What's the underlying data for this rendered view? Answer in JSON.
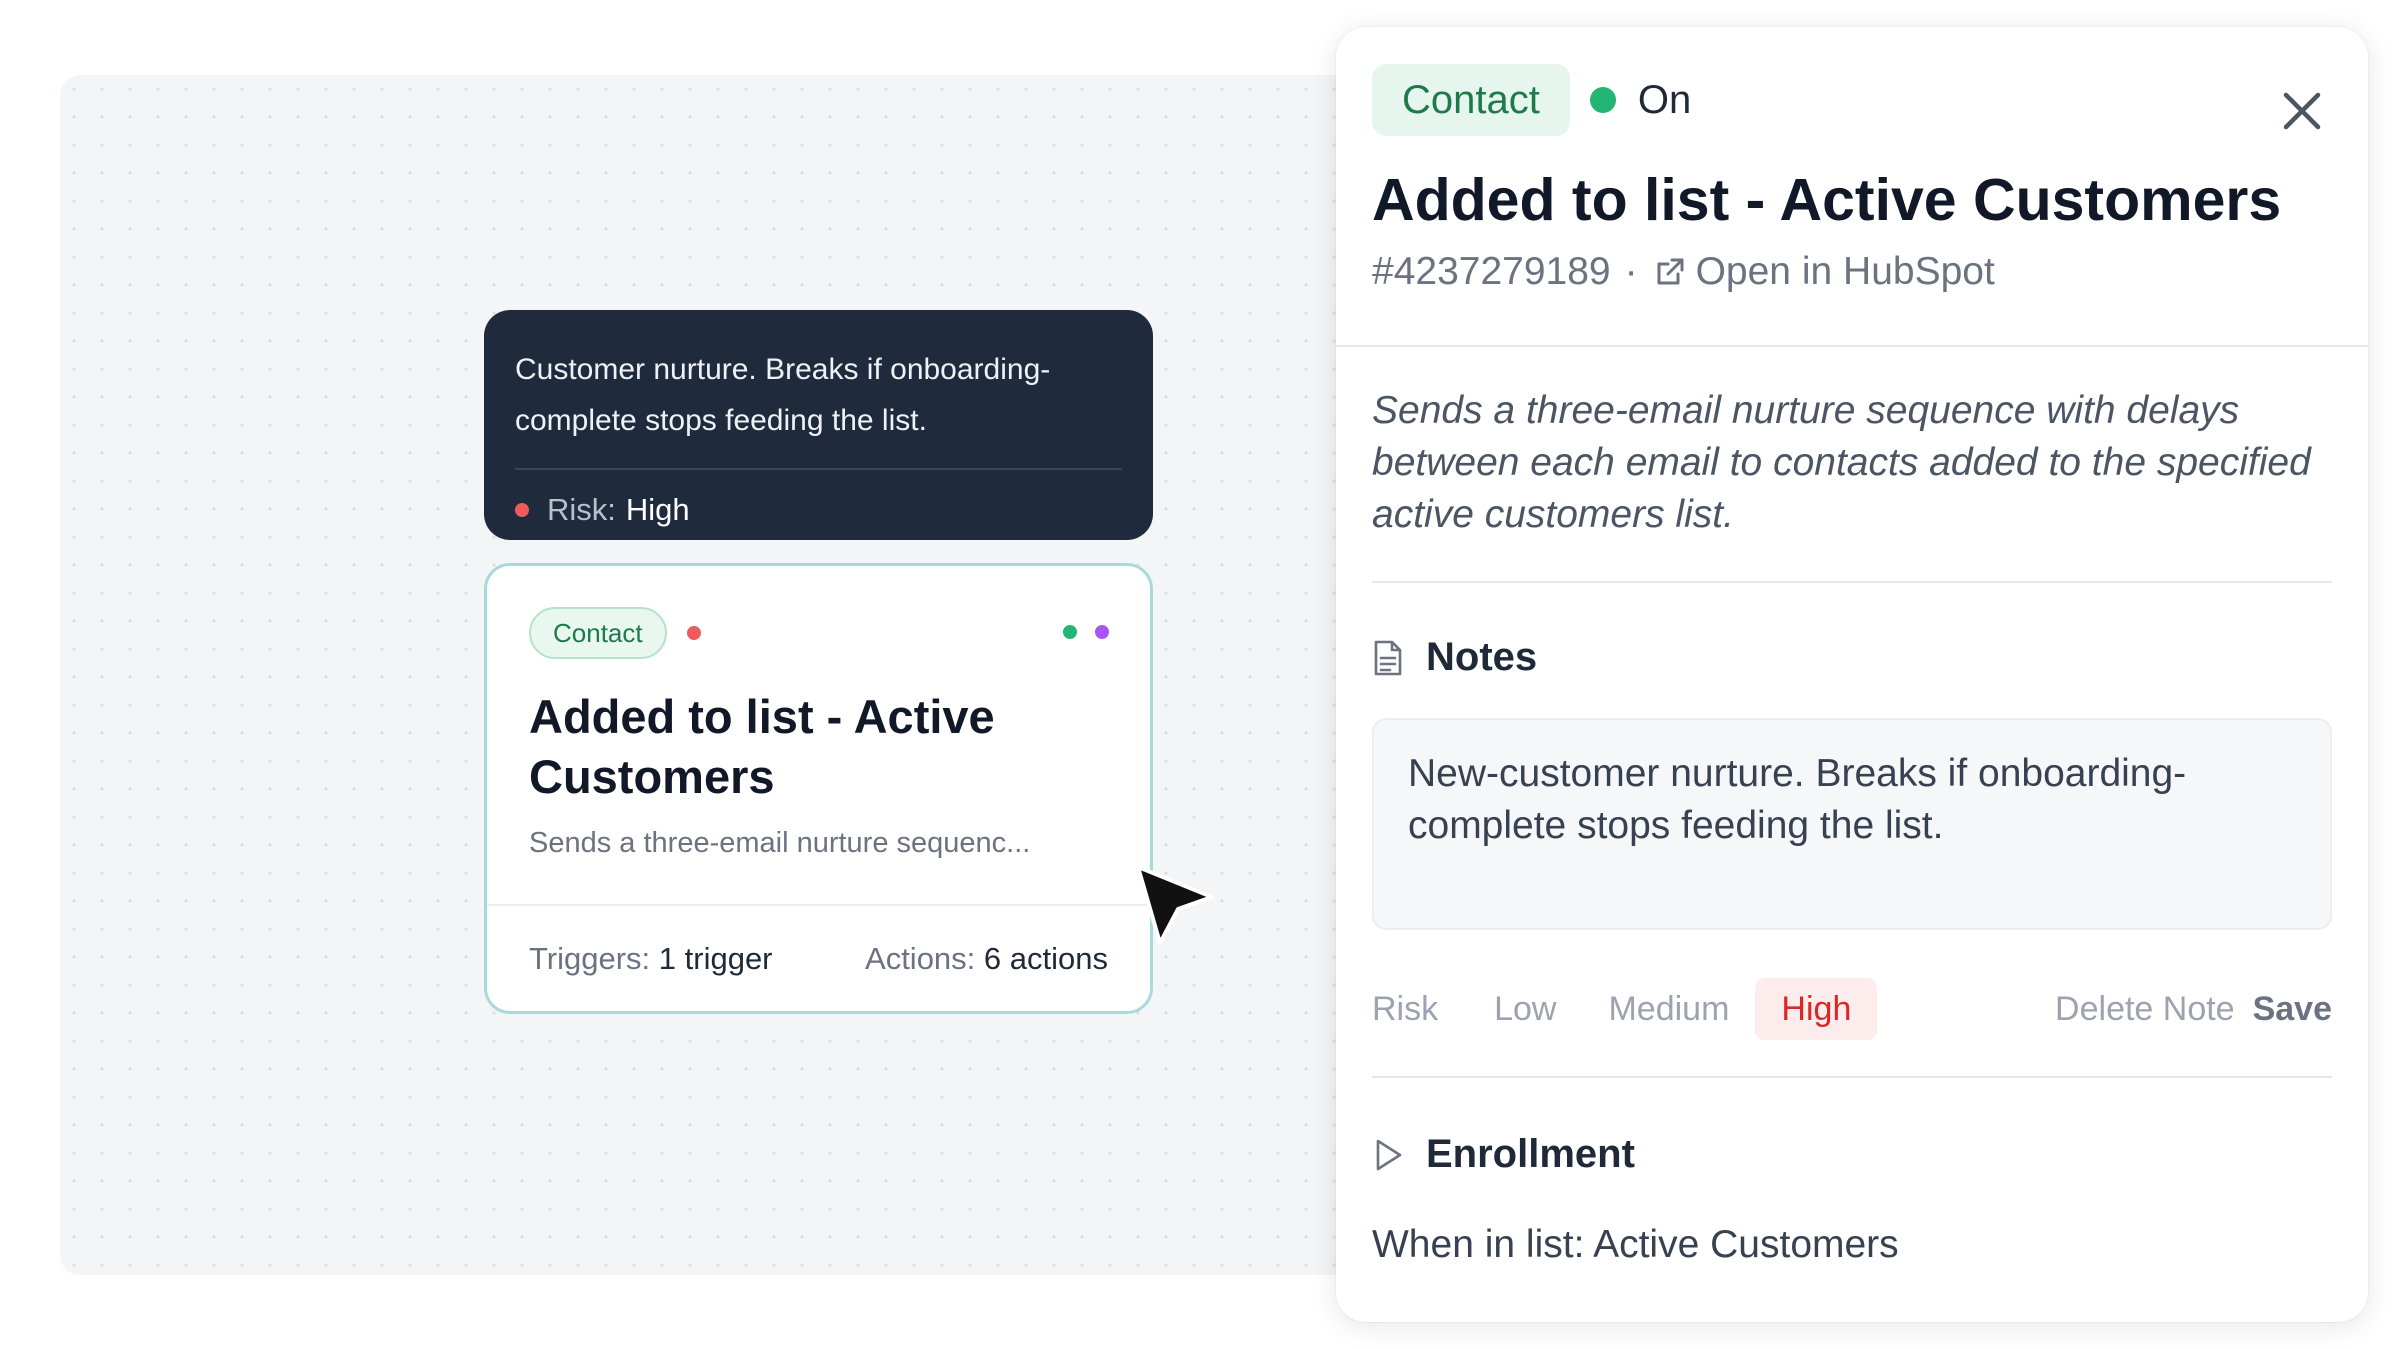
{
  "tooltip": {
    "description": "Customer nurture. Breaks if onboarding-complete stops feeding the list.",
    "risk_label": "Risk:",
    "risk_value": "High"
  },
  "card": {
    "tag": "Contact",
    "title": "Added to list - Active Customers",
    "description": "Sends a three-email nurture sequenc...",
    "triggers_label": "Triggers:",
    "triggers_value": "1 trigger",
    "actions_label": "Actions:",
    "actions_value": "6 actions",
    "status_dots": [
      "#22b573",
      "#a855f7"
    ]
  },
  "panel": {
    "tag": "Contact",
    "status": "On",
    "title": "Added to list - Active Customers",
    "id": "#4237279189",
    "separator": "·",
    "open_link": "Open in HubSpot",
    "description": "Sends a three-email nurture sequence with delays between each email to contacts added to the specified active customers list.",
    "notes": {
      "heading": "Notes",
      "text": "New-customer nurture. Breaks if onboarding-complete stops feeding the list."
    },
    "risk": {
      "label": "Risk",
      "options": [
        "Low",
        "Medium",
        "High"
      ],
      "selected": "High"
    },
    "delete_note": "Delete Note",
    "save": "Save",
    "enrollment": {
      "heading": "Enrollment",
      "text": "When in list: Active Customers"
    }
  },
  "colors": {
    "risk_high": "#ef5b5b",
    "status_on": "#22b573",
    "tag_green": "#1f7a4a",
    "tooltip_bg": "#1f2b3d"
  }
}
